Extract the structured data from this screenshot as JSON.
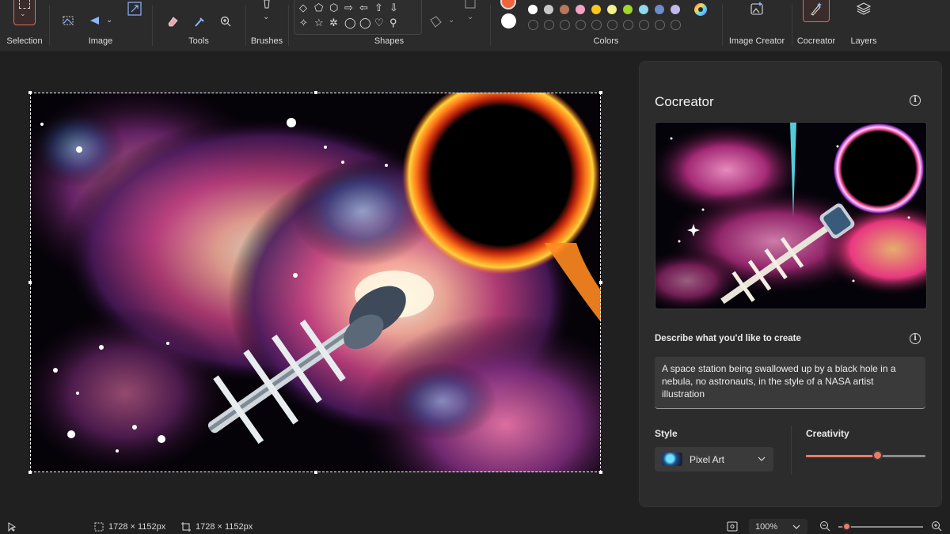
{
  "toolbar": {
    "groups": {
      "selection": "Selection",
      "image": "Image",
      "tools": "Tools",
      "brushes": "Brushes",
      "shapes": "Shapes",
      "colors": "Colors",
      "image_creator": "Image Creator",
      "cocreator": "Cocreator",
      "layers": "Layers"
    },
    "shape_glyphs": [
      "◇",
      "⬠",
      "⬡",
      "⇨",
      "⇦",
      "⇧",
      "⇩",
      "✧",
      "☆",
      "✲",
      "◯",
      "◯",
      "♡",
      "⚲"
    ],
    "colors": {
      "primary": "#f0643c",
      "secondary": "#ffffff",
      "palette": [
        "#ffffff",
        "#c8c8c8",
        "#b9785b",
        "#f3a1c5",
        "#f7c71d",
        "#f4f08c",
        "#a1d62b",
        "#8fd8ef",
        "#6f8bc9",
        "#c2b8ea"
      ]
    },
    "icons": [
      "selection-rectangle-icon",
      "crop-icon",
      "resize-icon",
      "remove-background-icon",
      "flip-icon",
      "eraser-icon",
      "color-picker-icon",
      "magnifier-icon",
      "brush-icon",
      "fill-icon",
      "color-wheel-icon",
      "image-creator-icon",
      "cocreator-pen-icon",
      "layers-icon"
    ]
  },
  "canvas": {
    "description_icons": [
      "space-station",
      "black-hole",
      "nebula",
      "stars"
    ]
  },
  "cocreator": {
    "title": "Cocreator",
    "describe_label": "Describe what you'd like to create",
    "prompt": "A space station being swallowed up by a black hole in a nebula, no astronauts, in the style of a NASA artist illustration",
    "style_label": "Style",
    "style_value": "Pixel Art",
    "creativity_label": "Creativity",
    "creativity_level": 0.6
  },
  "statusbar": {
    "selection_size": "1728 × 1152px",
    "image_size": "1728 × 1152px",
    "zoom": "100%",
    "zoom_level": 0.1
  }
}
